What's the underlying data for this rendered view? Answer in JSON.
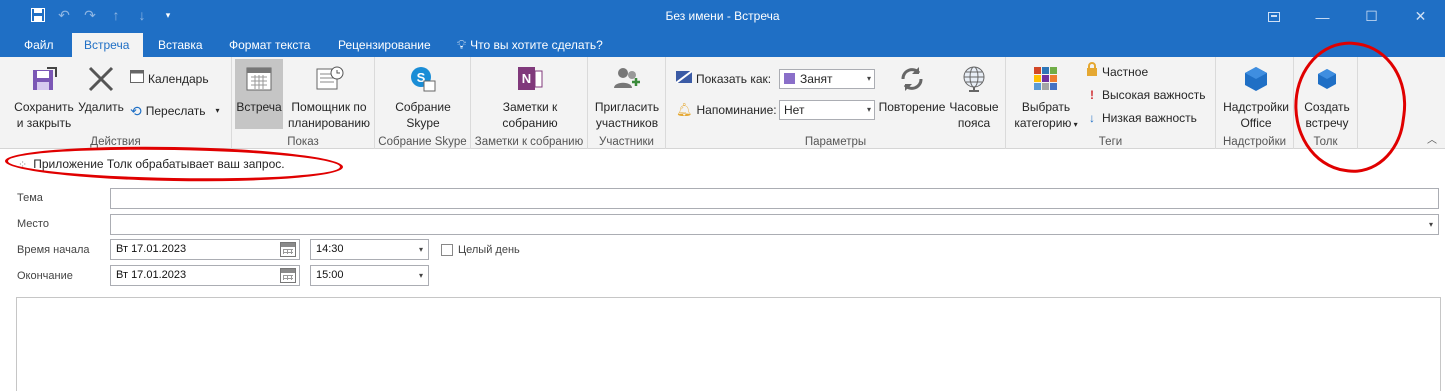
{
  "window": {
    "title": "Без имени - Встреча",
    "quick_access": [
      "save-icon",
      "undo-icon",
      "redo-icon",
      "up-arrow-icon",
      "down-arrow-icon",
      "customize-icon"
    ],
    "controls": [
      "ribbon-display-icon",
      "minimize-icon",
      "maximize-icon",
      "close-icon"
    ]
  },
  "tabs": [
    {
      "label": "Файл",
      "active": false
    },
    {
      "label": "Встреча",
      "active": true
    },
    {
      "label": "Вставка",
      "active": false
    },
    {
      "label": "Формат текста",
      "active": false
    },
    {
      "label": "Рецензирование",
      "active": false
    }
  ],
  "tellme": {
    "label": "Что вы хотите сделать?"
  },
  "ribbon": {
    "actions": {
      "label": "Действия",
      "save_close": [
        "Сохранить",
        "и закрыть"
      ],
      "delete": "Удалить",
      "calendar": "Календарь",
      "forward": "Переслать"
    },
    "show": {
      "label": "Показ",
      "meeting": "Встреча",
      "assistant": [
        "Помощник по",
        "планированию"
      ]
    },
    "skype": {
      "label": "Собрание Skype",
      "button": [
        "Собрание",
        "Skype"
      ]
    },
    "notes": {
      "label": "Заметки к собранию",
      "button": [
        "Заметки к",
        "собранию"
      ]
    },
    "attendees": {
      "label": "Участники",
      "button": [
        "Пригласить",
        "участников"
      ]
    },
    "options": {
      "label": "Параметры",
      "show_as_label": "Показать как:",
      "show_as_value": "Занят",
      "reminder_label": "Напоминание:",
      "reminder_value": "Нет",
      "recurrence": "Повторение",
      "timezones": [
        "Часовые",
        "пояса"
      ]
    },
    "tags": {
      "label": "Теги",
      "categorize": [
        "Выбрать",
        "категорию"
      ],
      "private": "Частное",
      "high": "Высокая важность",
      "low": "Низкая важность"
    },
    "addins": {
      "label": "Надстройки",
      "button": [
        "Надстройки",
        "Office"
      ]
    },
    "tolk": {
      "label": "Толк",
      "button": [
        "Создать",
        "встречу"
      ]
    }
  },
  "infobar": {
    "text": "Приложение Толк обрабатывает ваш запрос."
  },
  "form": {
    "subject_label": "Тема",
    "subject_value": "",
    "location_label": "Место",
    "location_value": "",
    "start_label": "Время начала",
    "start_date": "Вт 17.01.2023",
    "start_time": "14:30",
    "allday_label": "Целый день",
    "allday_checked": false,
    "end_label": "Окончание",
    "end_date": "Вт 17.01.2023",
    "end_time": "15:00"
  },
  "colors": {
    "accent": "#1f6fc5",
    "annotation": "#e00000",
    "busy_swatch": "#8a6fc9"
  }
}
